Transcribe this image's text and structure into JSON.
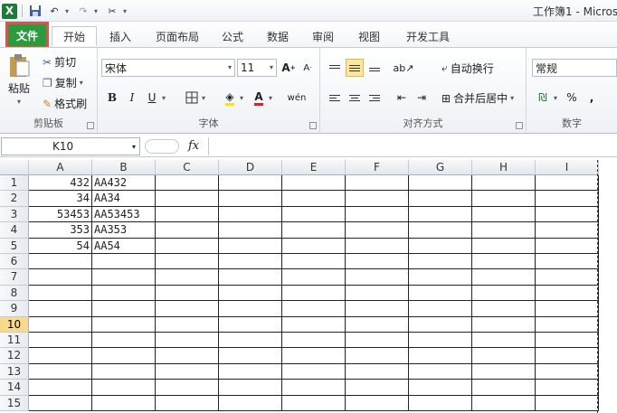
{
  "window": {
    "title": "工作簿1 - Micros"
  },
  "tabs": {
    "file": "文件",
    "items": [
      "开始",
      "插入",
      "页面布局",
      "公式",
      "数据",
      "审阅",
      "视图",
      "开发工具"
    ]
  },
  "ribbon": {
    "clipboard": {
      "paste": "粘贴",
      "cut": "剪切",
      "copy": "复制",
      "format_painter": "格式刷",
      "label": "剪贴板"
    },
    "font": {
      "name": "宋体",
      "size": "11",
      "bold": "B",
      "italic": "I",
      "underline": "U",
      "font_color_letter": "A",
      "label": "字体"
    },
    "alignment": {
      "wrap": "自动换行",
      "merge": "合并后居中",
      "label": "对齐方式"
    },
    "number": {
      "format": "常规",
      "percent": "%",
      "comma": ",",
      "label": "数字"
    }
  },
  "formula_bar": {
    "name_box": "K10",
    "fx": "fx",
    "value": ""
  },
  "sheet": {
    "columns": [
      "A",
      "B",
      "C",
      "D",
      "E",
      "F",
      "G",
      "H",
      "I"
    ],
    "rows": [
      "1",
      "2",
      "3",
      "4",
      "5",
      "6",
      "7",
      "8",
      "9",
      "10",
      "11",
      "12",
      "13",
      "14",
      "15"
    ],
    "selected_row": "10",
    "cells": [
      {
        "a": "432",
        "b": "AA432"
      },
      {
        "a": "34",
        "b": "AA34"
      },
      {
        "a": "53453",
        "b": "AA53453"
      },
      {
        "a": "353",
        "b": "AA353"
      },
      {
        "a": "54",
        "b": "AA54"
      }
    ]
  },
  "colors": {
    "file_tab": "#2a9b3e",
    "highlight": "#d9534f",
    "selected_header": "#f9d98a"
  }
}
